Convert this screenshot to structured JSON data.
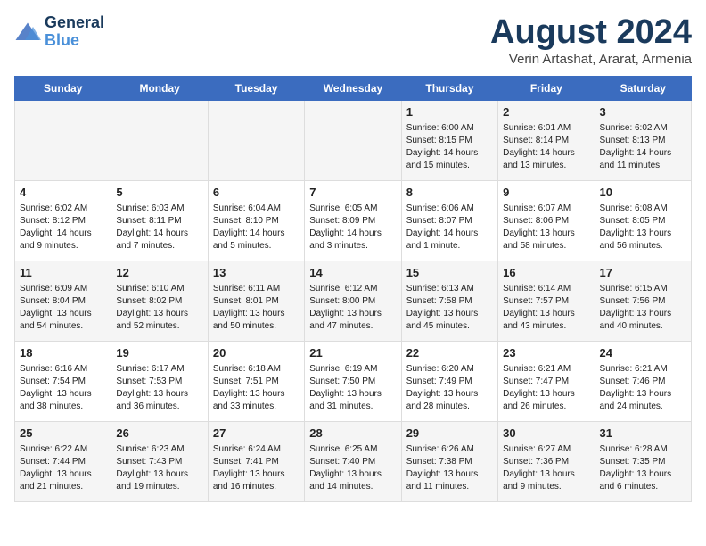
{
  "logo": {
    "line1": "General",
    "line2": "Blue"
  },
  "header": {
    "month": "August 2024",
    "location": "Verin Artashat, Ararat, Armenia"
  },
  "weekdays": [
    "Sunday",
    "Monday",
    "Tuesday",
    "Wednesday",
    "Thursday",
    "Friday",
    "Saturday"
  ],
  "weeks": [
    [
      {
        "day": "",
        "info": ""
      },
      {
        "day": "",
        "info": ""
      },
      {
        "day": "",
        "info": ""
      },
      {
        "day": "",
        "info": ""
      },
      {
        "day": "1",
        "info": "Sunrise: 6:00 AM\nSunset: 8:15 PM\nDaylight: 14 hours\nand 15 minutes."
      },
      {
        "day": "2",
        "info": "Sunrise: 6:01 AM\nSunset: 8:14 PM\nDaylight: 14 hours\nand 13 minutes."
      },
      {
        "day": "3",
        "info": "Sunrise: 6:02 AM\nSunset: 8:13 PM\nDaylight: 14 hours\nand 11 minutes."
      }
    ],
    [
      {
        "day": "4",
        "info": "Sunrise: 6:02 AM\nSunset: 8:12 PM\nDaylight: 14 hours\nand 9 minutes."
      },
      {
        "day": "5",
        "info": "Sunrise: 6:03 AM\nSunset: 8:11 PM\nDaylight: 14 hours\nand 7 minutes."
      },
      {
        "day": "6",
        "info": "Sunrise: 6:04 AM\nSunset: 8:10 PM\nDaylight: 14 hours\nand 5 minutes."
      },
      {
        "day": "7",
        "info": "Sunrise: 6:05 AM\nSunset: 8:09 PM\nDaylight: 14 hours\nand 3 minutes."
      },
      {
        "day": "8",
        "info": "Sunrise: 6:06 AM\nSunset: 8:07 PM\nDaylight: 14 hours\nand 1 minute."
      },
      {
        "day": "9",
        "info": "Sunrise: 6:07 AM\nSunset: 8:06 PM\nDaylight: 13 hours\nand 58 minutes."
      },
      {
        "day": "10",
        "info": "Sunrise: 6:08 AM\nSunset: 8:05 PM\nDaylight: 13 hours\nand 56 minutes."
      }
    ],
    [
      {
        "day": "11",
        "info": "Sunrise: 6:09 AM\nSunset: 8:04 PM\nDaylight: 13 hours\nand 54 minutes."
      },
      {
        "day": "12",
        "info": "Sunrise: 6:10 AM\nSunset: 8:02 PM\nDaylight: 13 hours\nand 52 minutes."
      },
      {
        "day": "13",
        "info": "Sunrise: 6:11 AM\nSunset: 8:01 PM\nDaylight: 13 hours\nand 50 minutes."
      },
      {
        "day": "14",
        "info": "Sunrise: 6:12 AM\nSunset: 8:00 PM\nDaylight: 13 hours\nand 47 minutes."
      },
      {
        "day": "15",
        "info": "Sunrise: 6:13 AM\nSunset: 7:58 PM\nDaylight: 13 hours\nand 45 minutes."
      },
      {
        "day": "16",
        "info": "Sunrise: 6:14 AM\nSunset: 7:57 PM\nDaylight: 13 hours\nand 43 minutes."
      },
      {
        "day": "17",
        "info": "Sunrise: 6:15 AM\nSunset: 7:56 PM\nDaylight: 13 hours\nand 40 minutes."
      }
    ],
    [
      {
        "day": "18",
        "info": "Sunrise: 6:16 AM\nSunset: 7:54 PM\nDaylight: 13 hours\nand 38 minutes."
      },
      {
        "day": "19",
        "info": "Sunrise: 6:17 AM\nSunset: 7:53 PM\nDaylight: 13 hours\nand 36 minutes."
      },
      {
        "day": "20",
        "info": "Sunrise: 6:18 AM\nSunset: 7:51 PM\nDaylight: 13 hours\nand 33 minutes."
      },
      {
        "day": "21",
        "info": "Sunrise: 6:19 AM\nSunset: 7:50 PM\nDaylight: 13 hours\nand 31 minutes."
      },
      {
        "day": "22",
        "info": "Sunrise: 6:20 AM\nSunset: 7:49 PM\nDaylight: 13 hours\nand 28 minutes."
      },
      {
        "day": "23",
        "info": "Sunrise: 6:21 AM\nSunset: 7:47 PM\nDaylight: 13 hours\nand 26 minutes."
      },
      {
        "day": "24",
        "info": "Sunrise: 6:21 AM\nSunset: 7:46 PM\nDaylight: 13 hours\nand 24 minutes."
      }
    ],
    [
      {
        "day": "25",
        "info": "Sunrise: 6:22 AM\nSunset: 7:44 PM\nDaylight: 13 hours\nand 21 minutes."
      },
      {
        "day": "26",
        "info": "Sunrise: 6:23 AM\nSunset: 7:43 PM\nDaylight: 13 hours\nand 19 minutes."
      },
      {
        "day": "27",
        "info": "Sunrise: 6:24 AM\nSunset: 7:41 PM\nDaylight: 13 hours\nand 16 minutes."
      },
      {
        "day": "28",
        "info": "Sunrise: 6:25 AM\nSunset: 7:40 PM\nDaylight: 13 hours\nand 14 minutes."
      },
      {
        "day": "29",
        "info": "Sunrise: 6:26 AM\nSunset: 7:38 PM\nDaylight: 13 hours\nand 11 minutes."
      },
      {
        "day": "30",
        "info": "Sunrise: 6:27 AM\nSunset: 7:36 PM\nDaylight: 13 hours\nand 9 minutes."
      },
      {
        "day": "31",
        "info": "Sunrise: 6:28 AM\nSunset: 7:35 PM\nDaylight: 13 hours\nand 6 minutes."
      }
    ]
  ]
}
